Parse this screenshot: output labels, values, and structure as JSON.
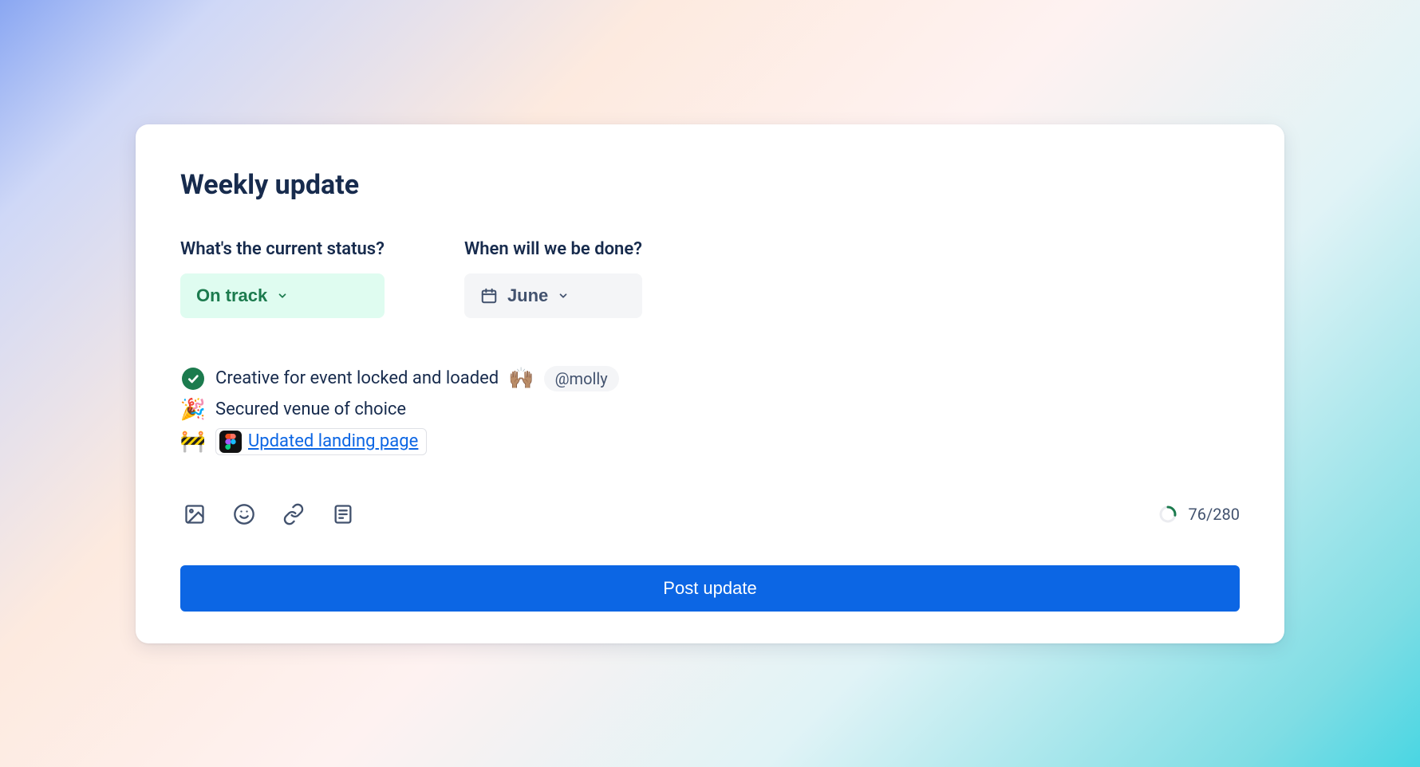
{
  "title": "Weekly update",
  "fields": {
    "status": {
      "label": "What's the current status?",
      "value": "On track"
    },
    "due": {
      "label": "When will we be done?",
      "value": "June"
    }
  },
  "items": [
    {
      "icon": "check",
      "text": "Creative for event locked and loaded",
      "emoji": "🙌🏽",
      "mention": "@molly"
    },
    {
      "icon": "party",
      "text": "Secured venue of choice"
    },
    {
      "icon": "construction",
      "link_text": "Updated landing page",
      "link_app": "figma"
    }
  ],
  "counter": {
    "used": 76,
    "max": 280,
    "display": "76/280"
  },
  "post_button": "Post update"
}
